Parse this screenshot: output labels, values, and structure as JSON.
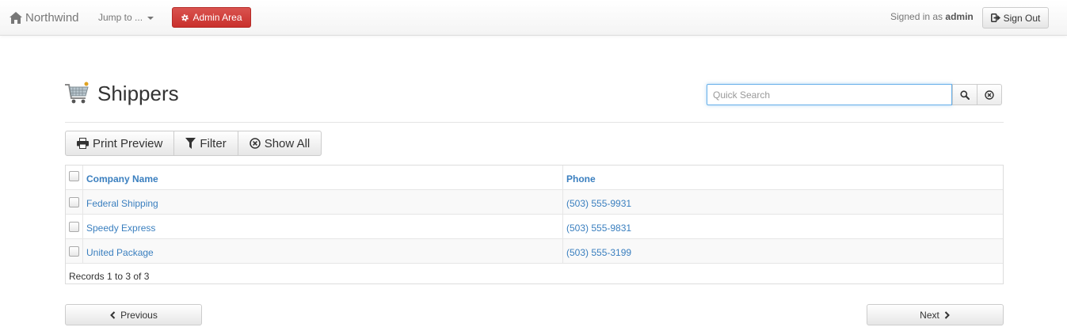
{
  "navbar": {
    "brand": "Northwind",
    "jump_menu": "Jump to ...",
    "admin_button": "Admin Area",
    "signed_in_prefix": "Signed in as",
    "username": "admin",
    "sign_out": "Sign Out"
  },
  "page": {
    "title": "Shippers",
    "search_placeholder": "Quick Search",
    "search_value": ""
  },
  "toolbar": {
    "print_preview": "Print Preview",
    "filter": "Filter",
    "show_all": "Show All"
  },
  "table": {
    "headers": {
      "company": "Company Name",
      "phone": "Phone"
    },
    "rows": [
      {
        "company": "Federal Shipping",
        "phone": "(503) 555-9931"
      },
      {
        "company": "Speedy Express",
        "phone": "(503) 555-9831"
      },
      {
        "company": "United Package",
        "phone": "(503) 555-3199"
      }
    ],
    "records_text": "Records 1 to 3 of 3"
  },
  "pager": {
    "previous": "Previous",
    "next": "Next"
  },
  "colors": {
    "link": "#3a7fbf",
    "admin_button": "#d9534f",
    "focus_border": "#66afe9"
  },
  "icons": {
    "brand": "home-icon",
    "admin": "gear-icon",
    "sign_out": "sign-out-icon",
    "title": "shopping-cart-icon",
    "search": "search-icon",
    "clear": "clear-circle-icon",
    "print": "print-icon",
    "filter": "filter-icon",
    "show_all": "remove-circle-icon",
    "previous": "chevron-left-icon",
    "next": "chevron-right-icon"
  }
}
